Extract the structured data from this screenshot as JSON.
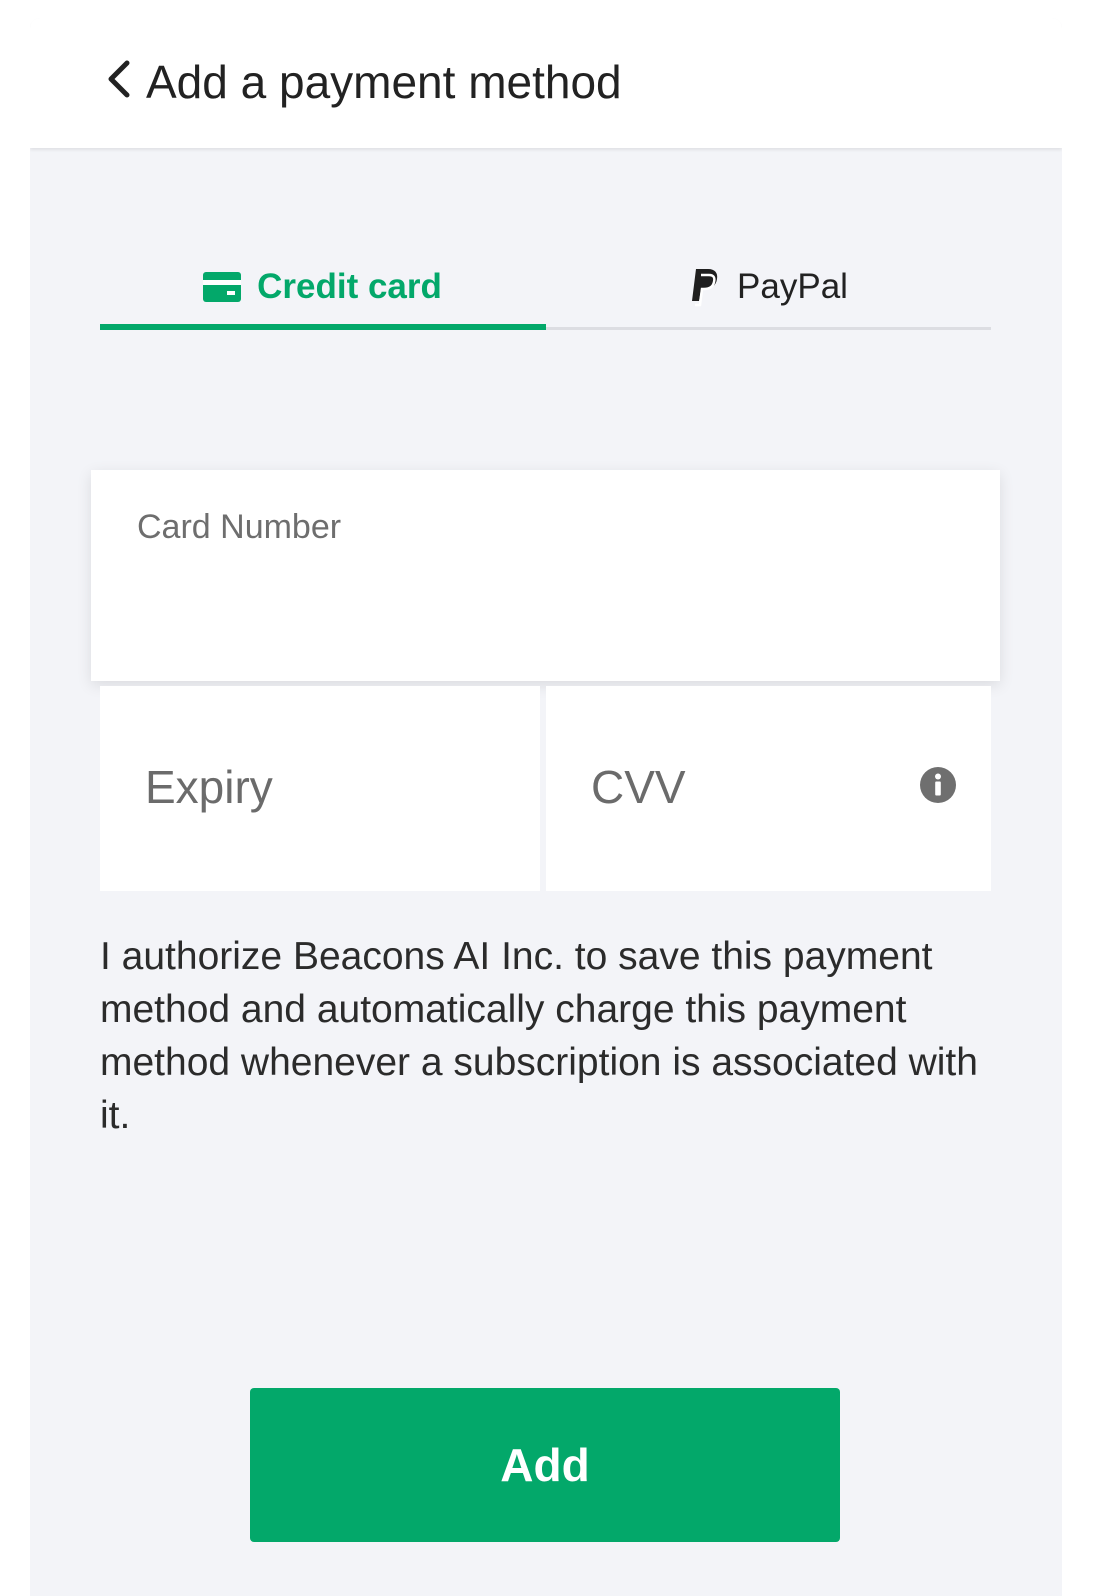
{
  "header": {
    "title": "Add a payment method",
    "back_icon": "chevron-left-icon"
  },
  "tabs": [
    {
      "label": "Credit card",
      "icon": "credit-card-icon",
      "active": true
    },
    {
      "label": "PayPal",
      "icon": "paypal-icon",
      "active": false
    }
  ],
  "form": {
    "card_number_label": "Card Number",
    "card_number_value": "",
    "expiry_placeholder": "Expiry",
    "cvv_placeholder": "CVV",
    "cvv_info_icon": "info-icon"
  },
  "consent_text": "I authorize Beacons AI Inc. to save this payment method and automatically charge this payment method whenever a subscription is associated with it.",
  "actions": {
    "add_label": "Add"
  },
  "colors": {
    "accent": "#03a86a",
    "background": "#f3f4f8",
    "text": "#2b2b2b"
  }
}
